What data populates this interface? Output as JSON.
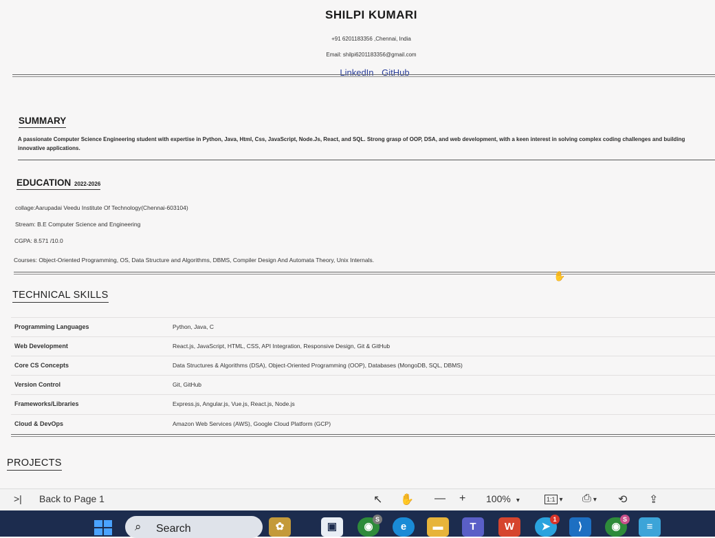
{
  "header": {
    "name": "SHILPI KUMARI",
    "contact": "+91 6201183356 ,Chennai, India",
    "email": "Email: shilpi6201183356@gmail.com",
    "links": [
      "LinkedIn",
      "GitHub"
    ]
  },
  "summary": {
    "title": "SUMMARY",
    "text": "A passionate Computer Science Engineering student with expertise in Python, Java, Html, Css, JavaScript, Node.Js, React, and SQL. Strong grasp of OOP, DSA, and web development, with a keen interest in solving complex coding challenges and building innovative applications."
  },
  "education": {
    "title": "EDUCATION",
    "years": "2022-2026",
    "college": "collage:Aarupadai Veedu Institute Of Technology(Chennai-603104)",
    "stream": "Stream: B.E Computer Science and Engineering",
    "cgpa": "CGPA: 8.571 /10.0",
    "courses": "Courses: Object-Oriented Programming, OS, Data Structure and Algorithms, DBMS, Compiler Design And Automata Theory, Unix Internals."
  },
  "skills": {
    "title": "TECHNICAL SKILLS",
    "rows": [
      {
        "key": "Programming Languages",
        "value": "Python, Java, C"
      },
      {
        "key": "Web Development",
        "value": "React.js, JavaScript, HTML, CSS, API Integration, Responsive Design, Git & GitHub"
      },
      {
        "key": "Core CS Concepts",
        "value": "Data Structures & Algorithms (DSA), Object-Oriented Programming (OOP), Databases (MongoDB, SQL, DBMS)"
      },
      {
        "key": "Version Control",
        "value": "Git, GitHub"
      },
      {
        "key": "Frameworks/Libraries",
        "value": "Express.js, Angular.js, Vue.js, React.js, Node.js"
      },
      {
        "key": "Cloud & DevOps",
        "value": "Amazon Web Services (AWS), Google Cloud Platform (GCP)"
      }
    ]
  },
  "projects": {
    "title": "PROJECTS"
  },
  "toolbar": {
    "back_label": "Back to Page 1",
    "zoom": "100%",
    "page_fit": "1:1",
    "icons": [
      "skip-back-icon",
      "select-arrow-icon",
      "hand-tool-icon",
      "zoom-out-icon",
      "zoom-in-icon",
      "fit-page-icon",
      "print-icon",
      "rotate-icon",
      "share-icon"
    ]
  },
  "taskbar": {
    "search_label": "Search",
    "badges": {
      "chrome1": "S",
      "telegram": "1",
      "chrome2": "S"
    },
    "colors": {
      "background": "#1c2c4e",
      "accent": "#4aa3ff"
    }
  }
}
